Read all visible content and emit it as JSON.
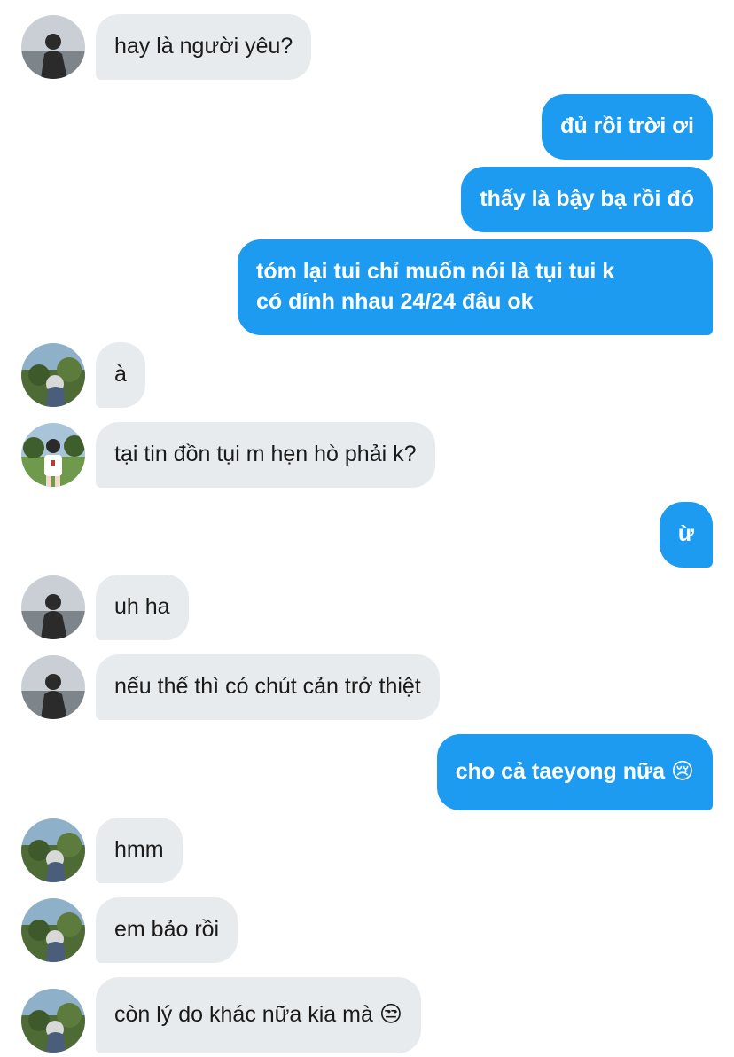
{
  "messages": [
    {
      "dir": "in",
      "text": "hay là người yêu?",
      "avatar": "silhouette-avatar"
    },
    {
      "dir": "out",
      "text": "đủ rồi trời ơi"
    },
    {
      "dir": "out",
      "text": "thấy là bậy bạ rồi đó"
    },
    {
      "dir": "out",
      "text": "tóm lại tui chỉ muốn nói là tụi tui k\ncó dính nhau 24/24 đâu ok"
    },
    {
      "dir": "in",
      "text": "à",
      "avatar": "garden-avatar"
    },
    {
      "dir": "in",
      "text": "tại tin đồn tụi m hẹn hò phải k?",
      "avatar": "park-avatar"
    },
    {
      "dir": "out",
      "text": "ừ"
    },
    {
      "dir": "in",
      "text": "uh ha",
      "avatar": "silhouette-avatar"
    },
    {
      "dir": "in",
      "text": "nếu thế thì có chút cản trở thiệt",
      "avatar": "silhouette-avatar"
    },
    {
      "dir": "out",
      "text": "cho cả taeyong nữa 😢"
    },
    {
      "dir": "in",
      "text": "hmm",
      "avatar": "garden-avatar"
    },
    {
      "dir": "in",
      "text": "em bảo rồi",
      "avatar": "garden-avatar"
    },
    {
      "dir": "in",
      "text": "còn lý do khác nữa kia mà 😒",
      "avatar": "garden-avatar"
    }
  ],
  "colors": {
    "outgoing_bubble": "#1d9bf0",
    "incoming_bubble": "#e8ebee",
    "background": "#ffffff"
  }
}
